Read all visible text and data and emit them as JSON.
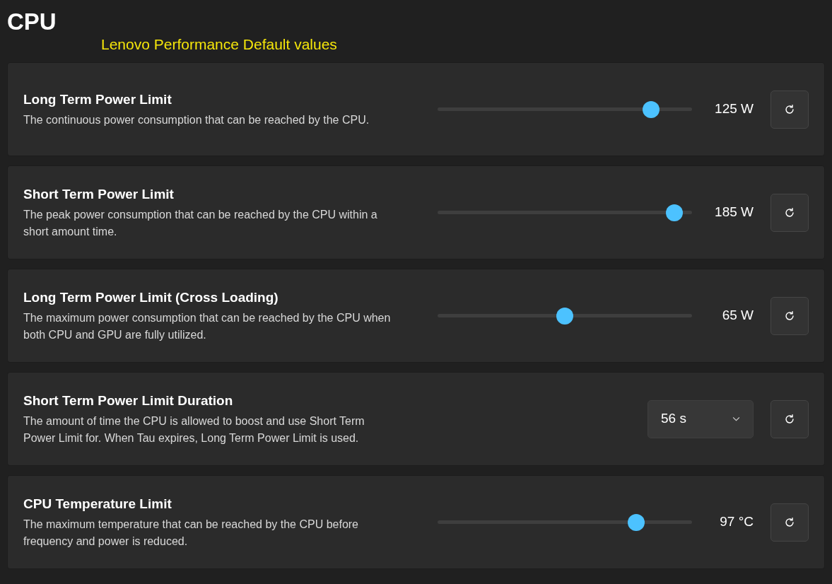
{
  "title": "CPU",
  "annotation": "Lenovo Performance Default values",
  "settings": [
    {
      "kind": "slider",
      "title": "Long Term Power Limit",
      "description": "The continuous power consumption that can be reached by the CPU.",
      "level": 0.84,
      "value": "125 W"
    },
    {
      "kind": "slider",
      "title": "Short Term Power Limit",
      "description": "The peak power consumption that can be reached by the CPU within a short amount time.",
      "level": 0.93,
      "value": "185 W"
    },
    {
      "kind": "slider",
      "title": "Long Term Power Limit (Cross Loading)",
      "description": "The maximum power consumption that can be reached by the CPU when both CPU and GPU are fully utilized.",
      "level": 0.5,
      "value": "65 W"
    },
    {
      "kind": "dropdown",
      "title": "Short Term Power Limit Duration",
      "description": "The amount of time the CPU is allowed to boost and use Short Term Power Limit for. When Tau expires, Long Term Power Limit is used.",
      "value": "56 s"
    },
    {
      "kind": "slider",
      "title": "CPU Temperature Limit",
      "description": "The maximum temperature that can be reached by the CPU before frequency and power is reduced.",
      "level": 0.78,
      "value": "97 °C"
    }
  ]
}
